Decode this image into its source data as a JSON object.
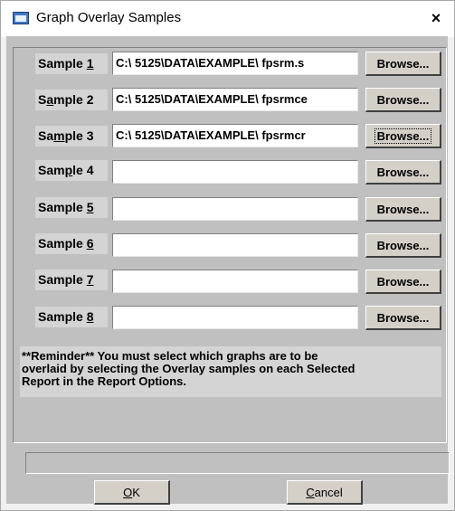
{
  "window": {
    "title": "Graph Overlay Samples",
    "close_glyph": "×"
  },
  "samples": [
    {
      "label_pre": "Sample ",
      "label_key": "1",
      "label_post": "",
      "path": "C:\\ 5125\\DATA\\EXAMPLE\\ fpsrm.s",
      "browse": "Browse..."
    },
    {
      "label_pre": "S",
      "label_key": "a",
      "label_post": "mple 2",
      "path": "C:\\ 5125\\DATA\\EXAMPLE\\ fpsrmce",
      "browse": "Browse..."
    },
    {
      "label_pre": "Sa",
      "label_key": "m",
      "label_post": "ple 3",
      "path": "C:\\ 5125\\DATA\\EXAMPLE\\ fpsrmcr",
      "browse": "Browse..."
    },
    {
      "label_pre": "Sam",
      "label_key": "p",
      "label_post": "le 4",
      "path": "",
      "browse": "Browse..."
    },
    {
      "label_pre": "Sample ",
      "label_key": "5",
      "label_post": "",
      "path": "",
      "browse": "Browse..."
    },
    {
      "label_pre": "Sample ",
      "label_key": "6",
      "label_post": "",
      "path": "",
      "browse": "Browse..."
    },
    {
      "label_pre": "Sample ",
      "label_key": "7",
      "label_post": "",
      "path": "",
      "browse": "Browse..."
    },
    {
      "label_pre": "Sample ",
      "label_key": "8",
      "label_post": "",
      "path": "",
      "browse": "Browse..."
    }
  ],
  "reminder": "**Reminder**     You must select which graphs are to be\noverlaid by selecting the Overlay samples on each Selected\nReport in the Report Options.",
  "buttons": {
    "ok_key": "O",
    "ok_rest": "K",
    "cancel_key": "C",
    "cancel_rest": "ancel"
  },
  "focused_browse_index": 2,
  "icons": {
    "title": "window-app-icon",
    "close": "close-icon"
  }
}
